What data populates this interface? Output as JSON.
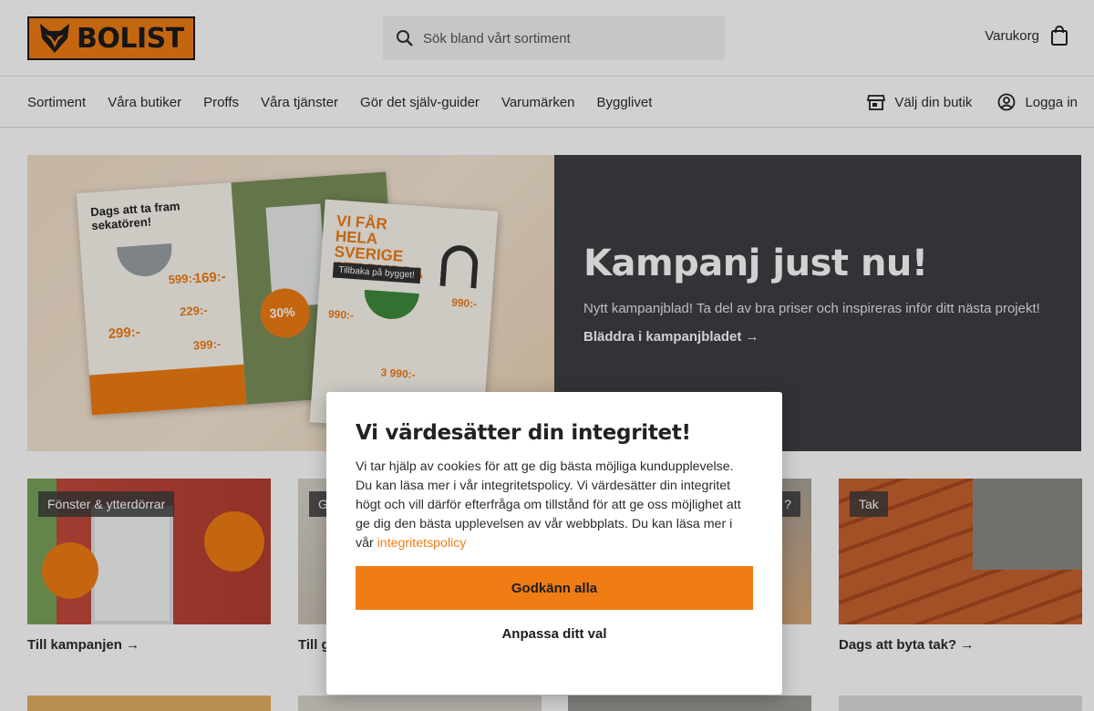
{
  "header": {
    "logo_text": "BOLIST",
    "search_placeholder": "Sök bland vårt sortiment",
    "cart_label": "Varukorg"
  },
  "nav": {
    "items": [
      "Sortiment",
      "Våra butiker",
      "Proffs",
      "Våra tjänster",
      "Gör det själv-guider",
      "Varumärken",
      "Bygglivet"
    ],
    "store_label": "Välj din butik",
    "login_label": "Logga in"
  },
  "hero": {
    "title": "Kampanj just nu!",
    "subtitle": "Nytt kampanjblad! Ta del av bra priser och inspireras inför ditt nästa projekt!",
    "link": "Bläddra i kampanjbladet →",
    "mag1_heading": "Dags att ta fram sekatören!",
    "mag2_heading": "VI FÅR HELA SVERIGE ATT BYGGA",
    "mag2_tag": "Tillbaka på bygget!",
    "prices": [
      "599:-",
      "169:-",
      "229:-",
      "299:-",
      "399:-",
      "990:-",
      "990:-",
      "3 990:-"
    ],
    "badge": "30%"
  },
  "cards": [
    {
      "label": "Fönster & ytterdörrar",
      "link": "Till kampanjen →"
    },
    {
      "label": "G",
      "link": "Till g"
    },
    {
      "label": "?",
      "link": ""
    },
    {
      "label": "Tak",
      "link": "Dags att byta tak? →"
    }
  ],
  "modal": {
    "title": "Vi värdesätter din integritet!",
    "body": "Vi tar hjälp av cookies för att ge dig bästa möjliga kundupplevelse. Du kan läsa mer i vår integritetspolicy. Vi värdesätter din integritet högt och vill därför efterfråga om tillstånd för att ge oss möjlighet att ge dig den bästa upplevelsen av vår webbplats. Du kan läsa mer i vår ",
    "policy_link": "integritetspolicy",
    "accept_label": "Godkänn alla",
    "customize_label": "Anpassa ditt val"
  },
  "colors": {
    "brand": "#f07d14",
    "hero_panel": "#3d3f44"
  }
}
